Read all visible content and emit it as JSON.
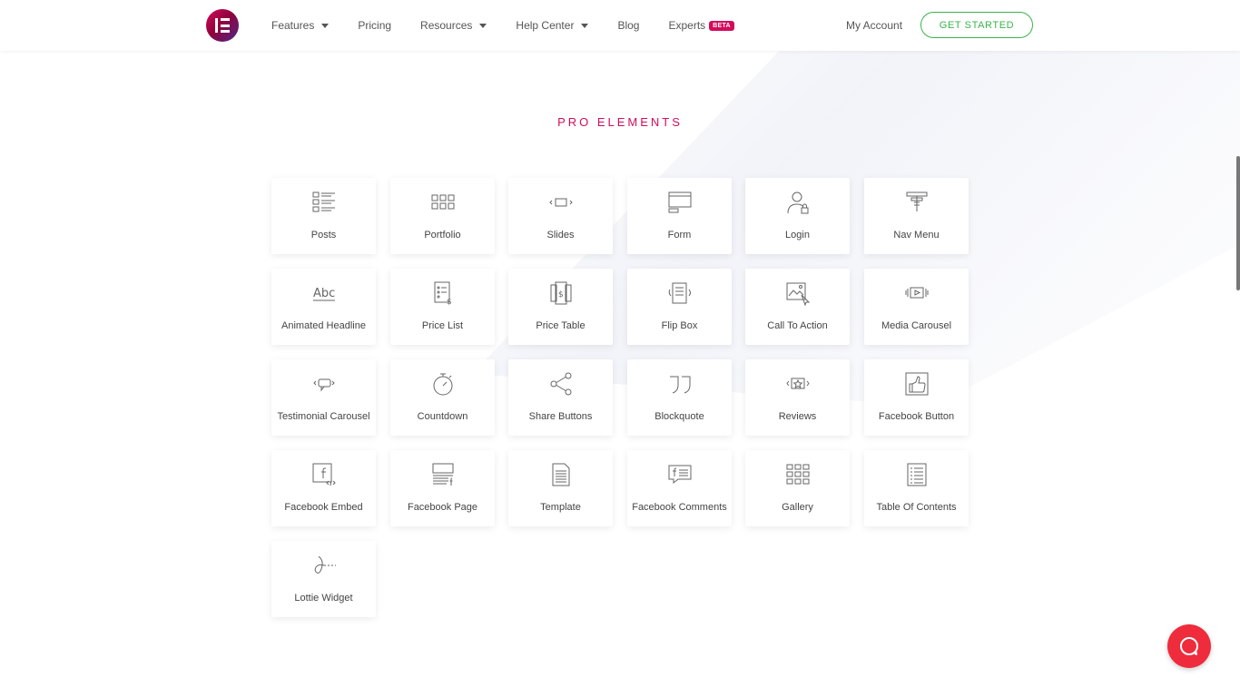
{
  "header": {
    "nav": [
      {
        "label": "Features",
        "dropdown": true
      },
      {
        "label": "Pricing",
        "dropdown": false
      },
      {
        "label": "Resources",
        "dropdown": true
      },
      {
        "label": "Help Center",
        "dropdown": true
      },
      {
        "label": "Blog",
        "dropdown": false
      },
      {
        "label": "Experts",
        "dropdown": false,
        "badge": "BETA"
      }
    ],
    "my_account": "My Account",
    "cta": "GET STARTED"
  },
  "section": {
    "title": "PRO ELEMENTS"
  },
  "widgets": [
    {
      "label": "Posts",
      "icon": "posts-icon"
    },
    {
      "label": "Portfolio",
      "icon": "portfolio-icon"
    },
    {
      "label": "Slides",
      "icon": "slides-icon"
    },
    {
      "label": "Form",
      "icon": "form-icon"
    },
    {
      "label": "Login",
      "icon": "login-icon"
    },
    {
      "label": "Nav Menu",
      "icon": "nav-menu-icon"
    },
    {
      "label": "Animated Headline",
      "icon": "animated-headline-icon"
    },
    {
      "label": "Price List",
      "icon": "price-list-icon"
    },
    {
      "label": "Price Table",
      "icon": "price-table-icon"
    },
    {
      "label": "Flip Box",
      "icon": "flip-box-icon"
    },
    {
      "label": "Call To Action",
      "icon": "call-to-action-icon"
    },
    {
      "label": "Media Carousel",
      "icon": "media-carousel-icon"
    },
    {
      "label": "Testimonial Carousel",
      "icon": "testimonial-carousel-icon"
    },
    {
      "label": "Countdown",
      "icon": "countdown-icon"
    },
    {
      "label": "Share Buttons",
      "icon": "share-icon"
    },
    {
      "label": "Blockquote",
      "icon": "blockquote-icon"
    },
    {
      "label": "Reviews",
      "icon": "reviews-icon"
    },
    {
      "label": "Facebook Button",
      "icon": "facebook-button-icon"
    },
    {
      "label": "Facebook Embed",
      "icon": "facebook-embed-icon"
    },
    {
      "label": "Facebook Page",
      "icon": "facebook-page-icon"
    },
    {
      "label": "Template",
      "icon": "template-icon"
    },
    {
      "label": "Facebook Comments",
      "icon": "facebook-comments-icon"
    },
    {
      "label": "Gallery",
      "icon": "gallery-icon"
    },
    {
      "label": "Table Of Contents",
      "icon": "table-of-contents-icon"
    },
    {
      "label": "Lottie Widget",
      "icon": "lottie-icon"
    }
  ],
  "colors": {
    "accent": "#d30c5c",
    "cta": "#39b54a",
    "chat": "#ee2c3c"
  }
}
